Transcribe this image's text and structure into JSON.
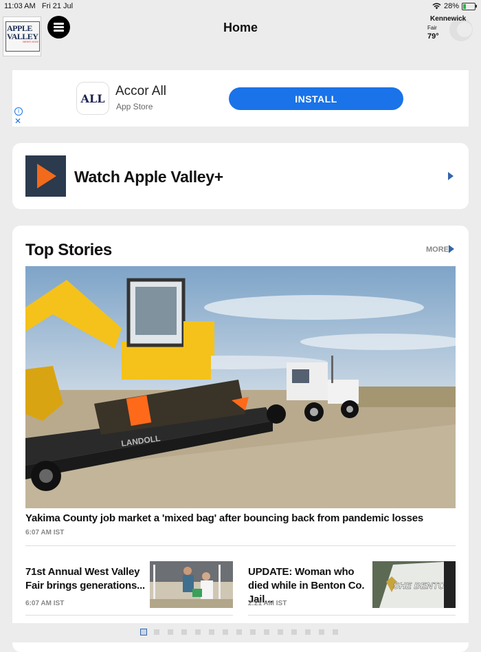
{
  "status_bar": {
    "time": "11:03 AM",
    "date": "Fri 21 Jul",
    "battery": "28%",
    "battery_level": 0.28
  },
  "header": {
    "title": "Home",
    "logo_line1": "APPLE",
    "logo_line2": "VALLEY",
    "logo_line3": "NEWS NOW"
  },
  "weather": {
    "city": "Kennewick",
    "condition": "Fair",
    "temperature": "79°"
  },
  "ad": {
    "app_icon_text": "ALL",
    "app_name": "Accor All",
    "store": "App Store",
    "install_label": "INSTALL"
  },
  "watch": {
    "label": "Watch Apple Valley+"
  },
  "top_stories": {
    "heading": "Top Stories",
    "more_label": "MORE",
    "lead": {
      "headline": "Yakima County job market a 'mixed bag' after bouncing back from pandemic losses",
      "time": "6:07 AM IST",
      "image_text": "LANDOLL"
    },
    "items": [
      {
        "title": "71st Annual West Valley Fair brings generations...",
        "time": "6:07 AM IST"
      },
      {
        "title": "UPDATE: Woman who died while in Benton Co. Jail...",
        "time": "2:21 AM IST",
        "image_text": "SHE BENTON"
      }
    ]
  },
  "pager": {
    "pages": 15,
    "active": 0
  },
  "colors": {
    "accent": "#1a73e8",
    "brand_arrow": "#3366aa",
    "play_orange": "#f26a1b"
  }
}
